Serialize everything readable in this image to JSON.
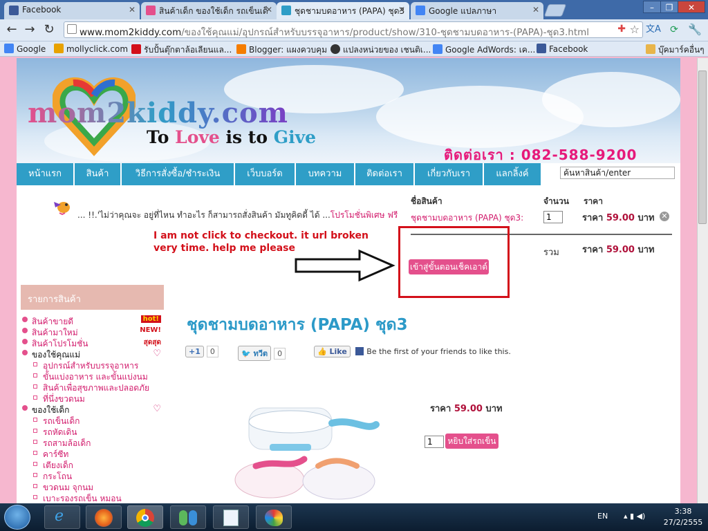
{
  "browser": {
    "tabs": [
      {
        "title": "Facebook",
        "color": "#3b5998"
      },
      {
        "title": "สินค้าเด็ก ของใช้เด็ก รถเข็นเด็",
        "color": "#e4508c"
      },
      {
        "title": "ชุดชามบดอาหาร (PAPA) ชุด3",
        "color": "#2f9ec7"
      },
      {
        "title": "Google แปลภาษา",
        "color": "#4285f4"
      }
    ],
    "url_host": "www.mom2kiddy.com",
    "url_path": "/ของใช้คุณแม่/อุปกรณ์สำหรับบรรจุอาหาร/product/show/310-ชุดชามบดอาหาร-(PAPA)-ชุด3.html",
    "bookmarks": [
      {
        "label": "Google",
        "color": "#4285f4"
      },
      {
        "label": "mollyclick.com",
        "color": "#e8a200"
      },
      {
        "label": "รับปั้นตุ๊กตาล้อเลียนแล...",
        "color": "#d3101a"
      },
      {
        "label": "Blogger: แผงควบคุม",
        "color": "#f57d00"
      },
      {
        "label": "แปลงหน่วยของ เชนติเ...",
        "color": "#333333"
      },
      {
        "label": "Google AdWords: เค...",
        "color": "#4285f4"
      },
      {
        "label": "Facebook",
        "color": "#3b5998"
      }
    ],
    "other_bookmarks": "บุ๊คมาร์คอื่นๆ"
  },
  "site": {
    "logo": "mom2kiddy.com",
    "tagline_pre": "To ",
    "tagline_love": "Love",
    "tagline_mid": " is to ",
    "tagline_give": "Give",
    "contact": "ติดต่อเรา : 082-588-9200",
    "nav": [
      "หน้าแรก",
      "สินค้า",
      "วิธีการสั่งซื้อ/ชำระเงิน",
      "เว็บบอร์ด",
      "บทความ",
      "ติดต่อเรา",
      "เกี่ยวกับเรา",
      "แลกลิ้งค์"
    ],
    "search_value": "ค้นหาสินค้า/enter"
  },
  "marquee": {
    "text": "... !!.'ไม่ว่าคุณจะ อยู่ที่ไหน ทำอะไร ก็สามารถสั่งสินค้า มัมทูคิดดี้ ได้ ...",
    "highlight": "โปรโมชั่นพิเศษ ฟรี"
  },
  "cart": {
    "col_name": "ชื่อสินค้า",
    "col_qty": "จำนวน",
    "col_price": "ราคา",
    "item_name": "ชุดชามบดอาหาร (PAPA) ชุด3:",
    "item_qty": "1",
    "price_label": "ราคา",
    "item_price": "59.00",
    "currency": "บาท",
    "total_label": "รวม",
    "total_price": "59.00",
    "checkout_button": "เข้าสู่ขั้นตอนเช็คเอาต์"
  },
  "annotation": {
    "note": "I am not click to checkout. it url broken very time. help me please"
  },
  "sidebar": {
    "header": "รายการสินค้า",
    "items": [
      {
        "label": "สินค้าขายดี",
        "badge": "hot!"
      },
      {
        "label": "สินค้ามาใหม่",
        "badge": "NEW!"
      },
      {
        "label": "สินค้าโปรโมชั่น",
        "badge": "สุดสุด"
      },
      {
        "label": "ของใช้คุณแม่"
      },
      {
        "label": "อุปกรณ์สำหรับบรรจุอาหาร"
      },
      {
        "label": "ขั้นแบ่งอาหาร และขั้นแบ่งนม"
      },
      {
        "label": "สินค้าเพื่อสุขภาพและปลอดภัย"
      },
      {
        "label": "ที่นึ่งขวดนม"
      },
      {
        "label": "ของใช้เด็ก"
      },
      {
        "label": "รถเข็นเด็ก"
      },
      {
        "label": "รถหัดเดิน"
      },
      {
        "label": "รถสามล้อเด็ก"
      },
      {
        "label": "คาร์ซีท"
      },
      {
        "label": "เตียงเด็ก"
      },
      {
        "label": "กระโถน"
      },
      {
        "label": "ขวดนม จุกนม"
      },
      {
        "label": "เบาะรองรถเข็น หมอน"
      }
    ]
  },
  "product": {
    "title": "ชุดชามบดอาหาร (PAPA) ชุด3",
    "gplus_label": "+1",
    "gplus_count": "0",
    "tweet_label": "ทวีต",
    "tweet_count": "0",
    "like_label": "Like",
    "like_text": "Be the first of your friends to like this.",
    "price_label": "ราคา",
    "price": "59.00",
    "currency": "บาท",
    "qty": "1",
    "add_to_cart": "หยิบใส่รถเข็น"
  },
  "taskbar": {
    "lang": "EN",
    "time": "3:38",
    "date": "27/2/2555"
  }
}
